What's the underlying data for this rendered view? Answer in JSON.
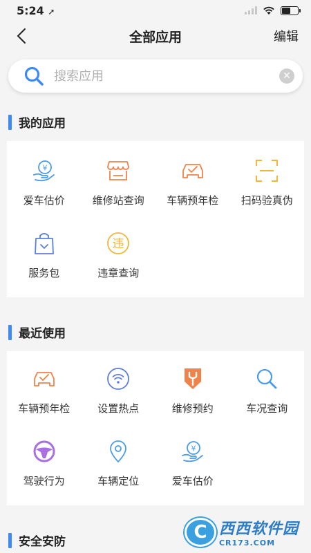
{
  "status_bar": {
    "time": "5:24"
  },
  "nav": {
    "title": "全部应用",
    "edit_label": "编辑"
  },
  "search": {
    "placeholder": "搜索应用"
  },
  "colors": {
    "accent": "#3d8bf2",
    "orange": "#f0834a",
    "gold": "#f3b63a",
    "blue": "#4a9be8",
    "purple": "#a86fe0"
  },
  "sections": [
    {
      "title": "我的应用",
      "apps": [
        {
          "label": "爱车估价",
          "icon": "yuan-hand-icon"
        },
        {
          "label": "维修站查询",
          "icon": "shop-icon"
        },
        {
          "label": "车辆预年检",
          "icon": "car-check-icon"
        },
        {
          "label": "扫码验真伪",
          "icon": "scan-icon"
        },
        {
          "label": "服务包",
          "icon": "bag-icon"
        },
        {
          "label": "违章查询",
          "icon": "violation-icon",
          "glyph": "违"
        }
      ]
    },
    {
      "title": "最近使用",
      "apps": [
        {
          "label": "车辆预年检",
          "icon": "car-check-icon"
        },
        {
          "label": "设置热点",
          "icon": "hotspot-icon"
        },
        {
          "label": "维修预约",
          "icon": "wrench-shield-icon"
        },
        {
          "label": "车况查询",
          "icon": "search-icon"
        },
        {
          "label": "驾驶行为",
          "icon": "steering-wheel-icon"
        },
        {
          "label": "车辆定位",
          "icon": "location-pin-icon"
        },
        {
          "label": "爱车估价",
          "icon": "yuan-hand-icon"
        }
      ]
    },
    {
      "title": "安全安防"
    }
  ],
  "watermark": {
    "logo_glyph": "C",
    "main": "西西软件园",
    "sub": "CR173.COM"
  }
}
